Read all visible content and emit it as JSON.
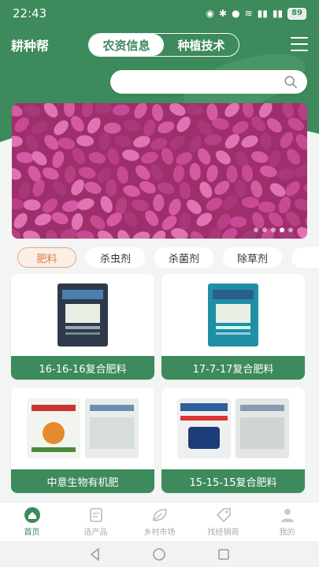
{
  "status": {
    "time": "22:43",
    "battery": "89"
  },
  "app": {
    "title": "耕种帮"
  },
  "segments": [
    {
      "label": "农资信息",
      "active": true
    },
    {
      "label": "种植技术",
      "active": false
    }
  ],
  "search": {
    "placeholder": ""
  },
  "banner": {
    "dots": 5,
    "active_dot": 3
  },
  "categories": [
    {
      "label": "肥料",
      "selected": true
    },
    {
      "label": "杀虫剂",
      "selected": false
    },
    {
      "label": "杀菌剂",
      "selected": false
    },
    {
      "label": "除草剂",
      "selected": false
    },
    {
      "label": "",
      "selected": false
    }
  ],
  "products": [
    {
      "name": "16-16-16复合肥料",
      "bag_text": "复合肥料"
    },
    {
      "name": "17-7-17复合肥料",
      "bag_text": "复合肥料"
    },
    {
      "name": "中意生物有机肥",
      "bag_text": "生物有机肥"
    },
    {
      "name": "15-15-15复合肥料",
      "bag_text": "复合肥料"
    }
  ],
  "bottom_nav": [
    {
      "label": "首页",
      "icon": "home-icon",
      "active": true
    },
    {
      "label": "选产品",
      "icon": "product-icon",
      "active": false
    },
    {
      "label": "乡村市场",
      "icon": "leaf-icon",
      "active": false
    },
    {
      "label": "找经销商",
      "icon": "tag-icon",
      "active": false
    },
    {
      "label": "我的",
      "icon": "user-icon",
      "active": false
    }
  ],
  "colors": {
    "primary": "#3d8a5c",
    "accent": "#e07a44",
    "banner": "#b03a7e"
  }
}
